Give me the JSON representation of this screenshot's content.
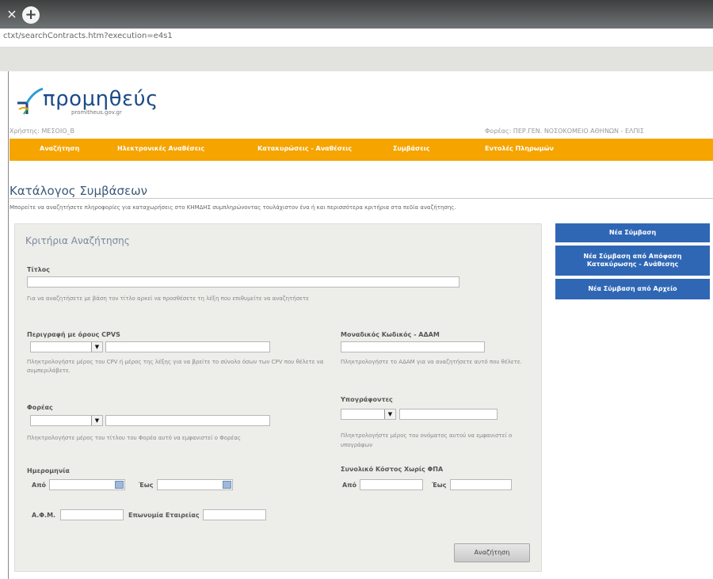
{
  "browser": {
    "tab_close": "×",
    "new_tab": "+",
    "url": "ctxt/searchContracts.htm?execution=e4s1"
  },
  "header": {
    "logo_text": "προμηθεύς",
    "logo_sub": "promitheus.gov.gr",
    "user_left": "Χρήστης: ΜΕΣΟΙΟ_Β",
    "user_right": "Φορέας: ΠΕΡ.ΓΕΝ. ΝΟΣΟΚΟΜΕΙΟ ΑΘΗΝΩΝ - ΕΛΠΙΣ"
  },
  "menu": {
    "items": [
      "Αναζήτηση",
      "Ηλεκτρονικές Αναθέσεις",
      "Κατακυρώσεις - Αναθέσεις",
      "Συμβάσεις",
      "Εντολές Πληρωμών"
    ]
  },
  "page": {
    "title": "Κατάλογος Συμβάσεων",
    "intro": "Μπορείτε να αναζητήσετε πληροφορίες για καταχωρήσεις στο ΚΗΜΔΗΣ συμπληρώνοντας τουλάχιστον ένα ή και περισσότερα κριτήρια στα πεδία αναζήτησης."
  },
  "search": {
    "panel_title": "Κριτήρια Αναζήτησης",
    "title_label": "Τίτλος",
    "title_hint": "Για να αναζητήσετε με βάση τον τίτλο αρκεί να προσθέσετε τη λέξη που επιθυμείτε να αναζητήσετε",
    "cpv_label": "Περιγραφή με όρους CPVS",
    "cpv_hint": "Πληκτρολογήστε μέρος του CPV ή μέρος της λέξης για να βρείτε το σύνολο όσων των CPV που θέλετε να συμπεριλάβετε.",
    "adam_label": "Μοναδικός Κωδικός - ΑΔΑΜ",
    "adam_hint": "Πληκτρολογήστε το ΑΔΑΜ για να αναζητήσετε αυτό που θέλετε.",
    "org_label": "Φορέας",
    "org_hint": "Πληκτρολογήστε μέρος του τίτλου του Φορέα αυτό να εμφανιστεί ο Φορέας",
    "signer_label": "Υπογράφοντες",
    "signer_hint": "Πληκτρολογήστε μέρος του ονόματος αυτού να εμφανιστεί ο υπογράφων",
    "date_label": "Ημερομηνία",
    "from_label": "Από",
    "to_label": "Έως",
    "cost_label": "Συνολικό Κόστος Χωρίς ΦΠΑ",
    "cost_from": "Από",
    "cost_to": "Έως",
    "afm_label": "Α.Φ.Μ.",
    "company_label": "Επωνυμία Εταιρείας",
    "search_button": "Αναζήτηση"
  },
  "actions": {
    "new_contract": "Νέα Σύμβαση",
    "new_from_decision": "Νέα Σύμβαση από Απόφαση Κατακύρωσης - Ανάθεσης",
    "new_from_file": "Νέα Σύμβαση από Αρχείο"
  },
  "colors": {
    "menu": "#f5a400",
    "action_button": "#2f67b5",
    "logo": "#1b4a8a"
  }
}
